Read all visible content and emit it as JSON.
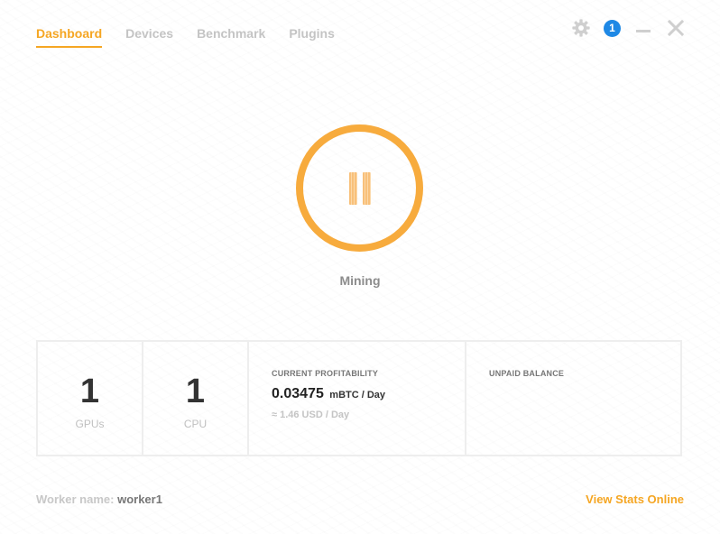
{
  "tabs": [
    {
      "label": "Dashboard",
      "active": true
    },
    {
      "label": "Devices",
      "active": false
    },
    {
      "label": "Benchmark",
      "active": false
    },
    {
      "label": "Plugins",
      "active": false
    }
  ],
  "window_controls": {
    "settings_icon": "gear-icon",
    "notification_count": "1",
    "minimize_icon": "minimize-icon",
    "close_icon": "close-icon"
  },
  "miner": {
    "button_icon": "pause-icon",
    "status": "Mining"
  },
  "stats": {
    "gpus": {
      "value": "1",
      "label": "GPUs"
    },
    "cpu": {
      "value": "1",
      "label": "CPU"
    },
    "profitability": {
      "title": "CURRENT PROFITABILITY",
      "value": "0.03475",
      "unit": "mBTC / Day",
      "usd": "≈ 1.46 USD / Day"
    },
    "balance": {
      "title": "UNPAID BALANCE"
    }
  },
  "footer": {
    "worker_label": "Worker name: ",
    "worker_value": "worker1",
    "view_stats_label": "View Stats Online"
  },
  "colors": {
    "accent": "#f5a623",
    "ring": "#f7ab3d",
    "badge": "#1e88e5"
  }
}
